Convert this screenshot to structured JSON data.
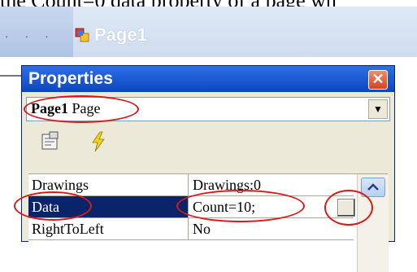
{
  "top_caption": "the Count=0 data property of a page wh",
  "toolbar": {
    "dots": "· · ·",
    "page_tab_label": "Page1"
  },
  "properties": {
    "title": "Properties",
    "close_glyph": "✕",
    "object_selector": {
      "name": "Page1",
      "type": "Page",
      "arrow": "▼"
    },
    "toolbar_icons": [
      "properties-icon",
      "events-bolt-icon"
    ],
    "rows": [
      {
        "name": "Drawings",
        "value": "Drawings:0"
      },
      {
        "name": "Data",
        "value": "Count=10;"
      },
      {
        "name": "RightToLeft",
        "value": "No"
      }
    ],
    "selected_row": "Data",
    "ellipsis_label": "..."
  },
  "colors": {
    "titlebar": "#0a46c0",
    "selection": "#0a246a",
    "annotation": "#d81a1a"
  }
}
